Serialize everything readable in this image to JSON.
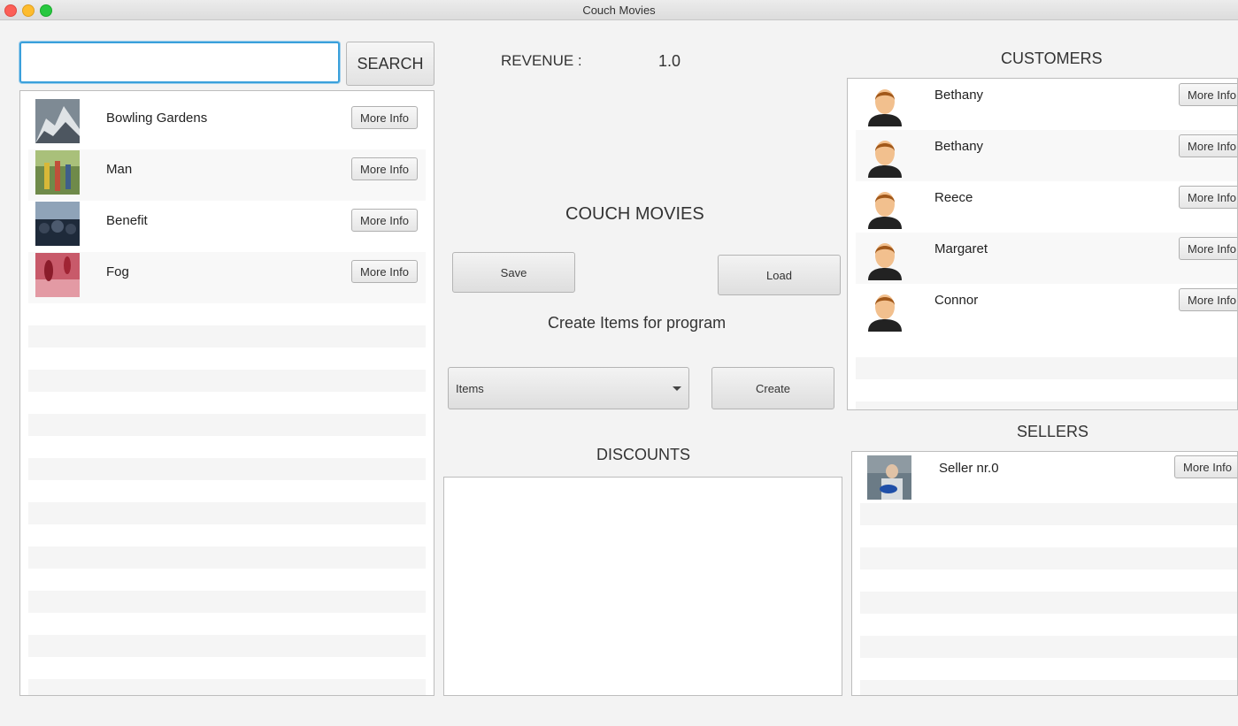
{
  "window": {
    "title": "Couch Movies"
  },
  "search": {
    "value": "",
    "button_label": "SEARCH"
  },
  "movies": [
    {
      "title": "Bowling Gardens",
      "button": "More Info",
      "thumb": "mountain-thumb"
    },
    {
      "title": "Man",
      "button": "More Info",
      "thumb": "forest-people-thumb"
    },
    {
      "title": "Benefit",
      "button": "More Info",
      "thumb": "crowd-thumb"
    },
    {
      "title": "Fog",
      "button": "More Info",
      "thumb": "red-figure-thumb"
    }
  ],
  "revenue": {
    "label": "REVENUE :",
    "value": "1.0"
  },
  "app_title": "COUCH MOVIES",
  "actions": {
    "save": "Save",
    "load": "Load"
  },
  "create_section": {
    "heading": "Create Items for program",
    "combo_value": "Items",
    "create_button": "Create"
  },
  "discounts": {
    "heading": "DISCOUNTS"
  },
  "customers": {
    "heading": "CUSTOMERS",
    "items": [
      {
        "name": "Bethany",
        "button": "More Info"
      },
      {
        "name": "Bethany",
        "button": "More Info"
      },
      {
        "name": "Reece",
        "button": "More Info"
      },
      {
        "name": "Margaret",
        "button": "More Info"
      },
      {
        "name": "Connor",
        "button": "More Info"
      }
    ]
  },
  "sellers": {
    "heading": "SELLERS",
    "items": [
      {
        "name": "Seller nr.0",
        "button": "More Info"
      }
    ]
  },
  "colors": {
    "focus_ring": "#3aa0db",
    "panel_bg": "#ffffff",
    "window_bg": "#f3f3f3"
  }
}
